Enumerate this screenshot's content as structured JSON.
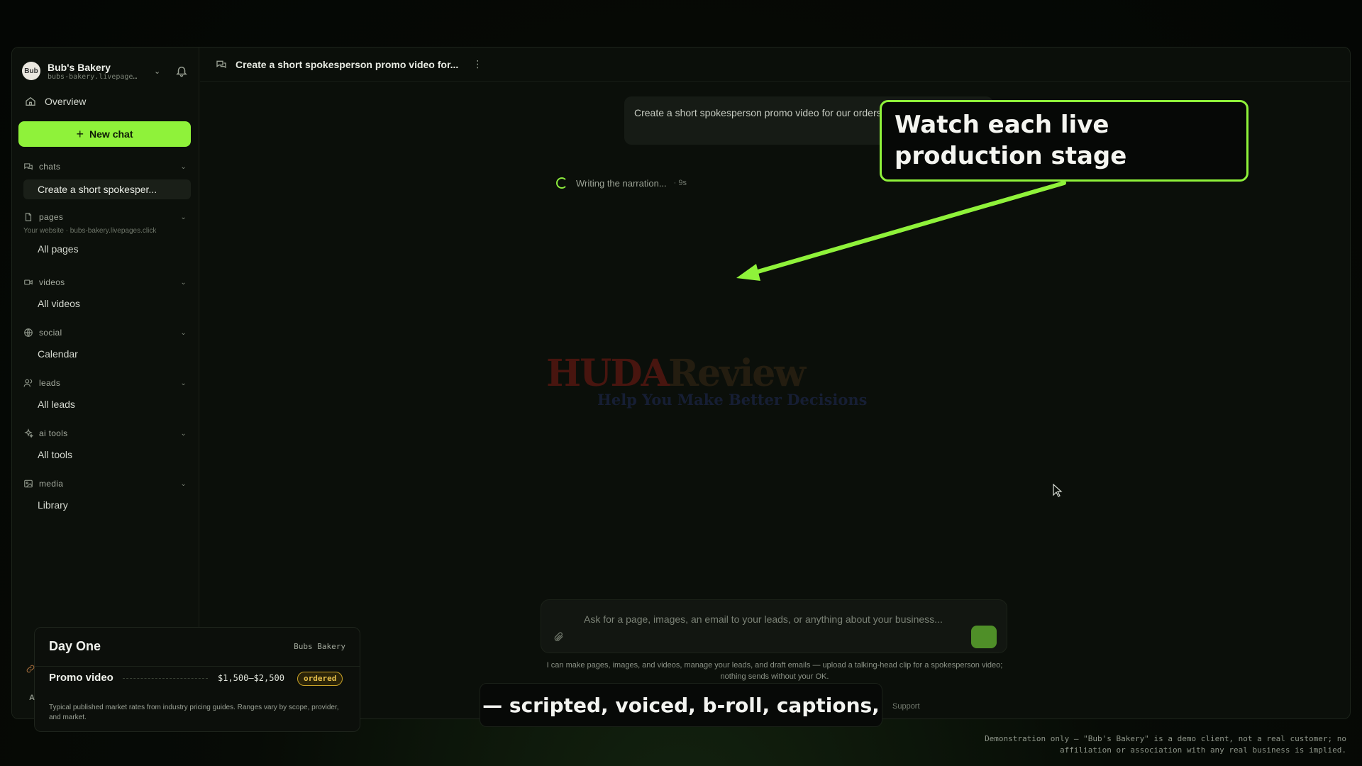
{
  "workspace": {
    "name": "Bub's Bakery",
    "url": "bubs-bakery.livepage…",
    "avatar_text": "Bub"
  },
  "nav": {
    "overview": "Overview",
    "new_chat": "New chat"
  },
  "sections": {
    "chats": {
      "label": "chats",
      "items": [
        "Create a short spokesper..."
      ]
    },
    "pages": {
      "label": "pages",
      "sub": "Your website · bubs-bakery.livepages.click",
      "items": [
        "All pages"
      ]
    },
    "videos": {
      "label": "videos",
      "items": [
        "All videos"
      ]
    },
    "social": {
      "label": "social",
      "items": [
        "Calendar"
      ]
    },
    "leads": {
      "label": "leads",
      "items": [
        "All leads"
      ]
    },
    "ai_tools": {
      "label": "ai tools",
      "items": [
        "All tools"
      ]
    },
    "media": {
      "label": "media",
      "items": [
        "Library"
      ]
    }
  },
  "header": {
    "title": "Create a short spokesperson promo video for..."
  },
  "chat": {
    "user_message": "Create a short spokesperson promo video for our orders.",
    "status": "Writing the narration...",
    "status_time": "· 9s"
  },
  "composer": {
    "placeholder": "Ask for a page, images, an email to your leads, or anything about your business...",
    "hint": "I can make pages, images, and videos, manage your leads, and draft emails — upload a talking-head clip for a spokesperson video; nothing sends without your OK.",
    "support": "Support"
  },
  "watermark": {
    "brand_a": "HUDA",
    "brand_b": "Review",
    "tagline": "Help You Make Better Decisions"
  },
  "callout": {
    "line1": "Watch each live",
    "line2": "production stage"
  },
  "price_card": {
    "title": "Day One",
    "client": "Bubs Bakery",
    "item": "Promo video",
    "price": "$1,500–$2,500",
    "badge": "ordered",
    "fine_print": "Typical published market rates from industry pricing guides. Ranges vary by scope, provider, and market."
  },
  "caption": "— scripted, voiced, b-roll, captions,",
  "disclaimer": {
    "line1": "Demonstration only — \"Bub's Bakery\" is a demo client, not a real customer; no",
    "line2": "affiliation or association with any real business is implied."
  },
  "edge_letter": "A",
  "colors": {
    "accent": "#8ff23a",
    "badge": "#e7c04a",
    "background": "#0b0f0a"
  }
}
